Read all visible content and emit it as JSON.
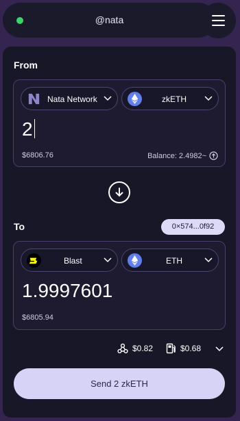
{
  "header": {
    "account_name": "@nata",
    "status_color": "#38d66b",
    "menu_icon": "hamburger-menu-icon"
  },
  "from": {
    "label": "From",
    "network": {
      "name": "Nata Network",
      "icon": "nata-network-logo"
    },
    "token": {
      "symbol": "zkETH",
      "icon": "ethereum-icon"
    },
    "amount": "2",
    "usd_value": "$6806.76",
    "balance": "Balance: 2.4982~",
    "max_icon": "arrow-up-circle-icon"
  },
  "swap_icon": "arrow-down-circle-icon",
  "to": {
    "label": "To",
    "recipient_address": "0×574...0f92",
    "network": {
      "name": "Blast",
      "icon": "blast-logo"
    },
    "token": {
      "symbol": "ETH",
      "icon": "ethereum-icon"
    },
    "amount": "1.9997601",
    "usd_value": "$6805.94"
  },
  "fees": {
    "bridge_fee": "$0.82",
    "gas_fee": "$0.68",
    "bridge_fee_icon": "nodes-icon",
    "gas_fee_icon": "gas-pump-icon"
  },
  "send_button": {
    "label": "Send 2 zkETH"
  },
  "colors": {
    "background": "#35244f",
    "panel": "#181727",
    "accent": "#d7d3f6",
    "border": "#4a3f6b"
  }
}
